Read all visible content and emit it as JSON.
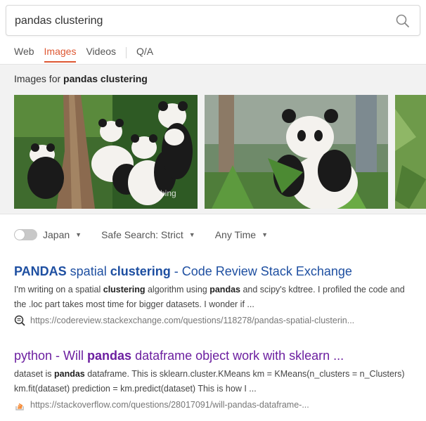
{
  "search": {
    "query": "pandas clustering",
    "placeholder": ""
  },
  "tabs": [
    {
      "label": "Web",
      "active": false
    },
    {
      "label": "Images",
      "active": true
    },
    {
      "label": "Videos",
      "active": false
    },
    {
      "label": "Q/A",
      "active": false
    }
  ],
  "images": {
    "heading_prefix": "Images for",
    "heading_query": "pandas clustering",
    "thumbs": [
      {
        "watermark": "bing"
      },
      {},
      {}
    ]
  },
  "filters": {
    "region": "Japan",
    "region_enabled": false,
    "safe_search": "Safe Search: Strict",
    "time": "Any Time"
  },
  "results": [
    {
      "title_parts": [
        {
          "text": "PANDAS",
          "bold": true
        },
        {
          "text": " spatial ",
          "bold": false
        },
        {
          "text": "clustering",
          "bold": true
        },
        {
          "text": " - Code Review Stack Exchange",
          "bold": false
        }
      ],
      "snippet_parts": [
        {
          "text": "I'm writing on a spatial ",
          "bold": false
        },
        {
          "text": "clustering",
          "bold": true
        },
        {
          "text": " algorithm using ",
          "bold": false
        },
        {
          "text": "pandas",
          "bold": true
        },
        {
          "text": " and scipy's kdtree. I profiled the code and the .loc part takes most time for bigger datasets. I wonder if ...",
          "bold": false
        }
      ],
      "url": "https://codereview.stackexchange.com/questions/118278/pandas-spatial-clusterin...",
      "favicon": "codereview-icon",
      "visited": false
    },
    {
      "title_parts": [
        {
          "text": "python - Will ",
          "bold": false
        },
        {
          "text": "pandas",
          "bold": true
        },
        {
          "text": " dataframe object work with sklearn ...",
          "bold": false
        }
      ],
      "snippet_parts": [
        {
          "text": "dataset is ",
          "bold": false
        },
        {
          "text": "pandas",
          "bold": true
        },
        {
          "text": " dataframe. This is sklearn.cluster.KMeans km = KMeans(n_clusters = n_Clusters) km.fit(dataset) prediction = km.predict(dataset) This is how I ...",
          "bold": false
        }
      ],
      "url": "https://stackoverflow.com/questions/28017091/will-pandas-dataframe-...",
      "favicon": "stackoverflow-icon",
      "visited": true
    }
  ],
  "colors": {
    "accent": "#de5833",
    "link": "#1e4fa1",
    "visited_link": "#6c1fa0"
  }
}
